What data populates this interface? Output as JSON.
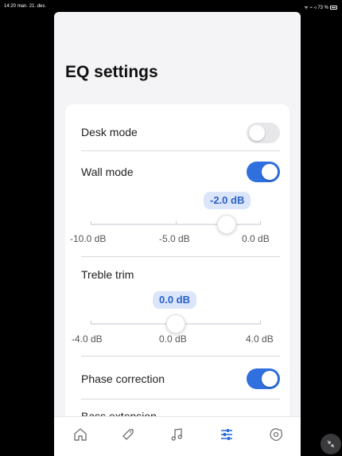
{
  "status_bar": {
    "time": "14:20",
    "date": "man. 21. des.",
    "right": "ᯤ ⌁ ◃ 73 %"
  },
  "page": {
    "title": "EQ settings"
  },
  "settings": {
    "desk_mode": {
      "label": "Desk mode",
      "enabled": false
    },
    "wall_mode": {
      "label": "Wall mode",
      "enabled": true,
      "value_label": "-2.0 dB",
      "value_db": -2.0,
      "scale": [
        "-10.0 dB",
        "-5.0 dB",
        "0.0 dB"
      ],
      "min_db": -10.0,
      "max_db": 0.0
    },
    "treble_trim": {
      "label": "Treble trim",
      "value_label": "0.0 dB",
      "value_db": 0.0,
      "scale": [
        "-4.0 dB",
        "0.0 dB",
        "4.0 dB"
      ],
      "min_db": -4.0,
      "max_db": 4.0
    },
    "phase_correction": {
      "label": "Phase correction",
      "enabled": true
    },
    "bass_extension": {
      "label": "Bass extension"
    }
  },
  "tab_bar": {
    "tabs": [
      {
        "icon": "home-icon"
      },
      {
        "icon": "tag-icon"
      },
      {
        "icon": "music-note-icon"
      },
      {
        "icon": "sliders-icon",
        "active": true
      },
      {
        "icon": "settings-icon"
      }
    ]
  },
  "colors": {
    "accent": "#2f6fde",
    "badge_bg": "#dbe6fb",
    "badge_text": "#2a5fc9",
    "toggle_off": "#e7e7ea"
  }
}
